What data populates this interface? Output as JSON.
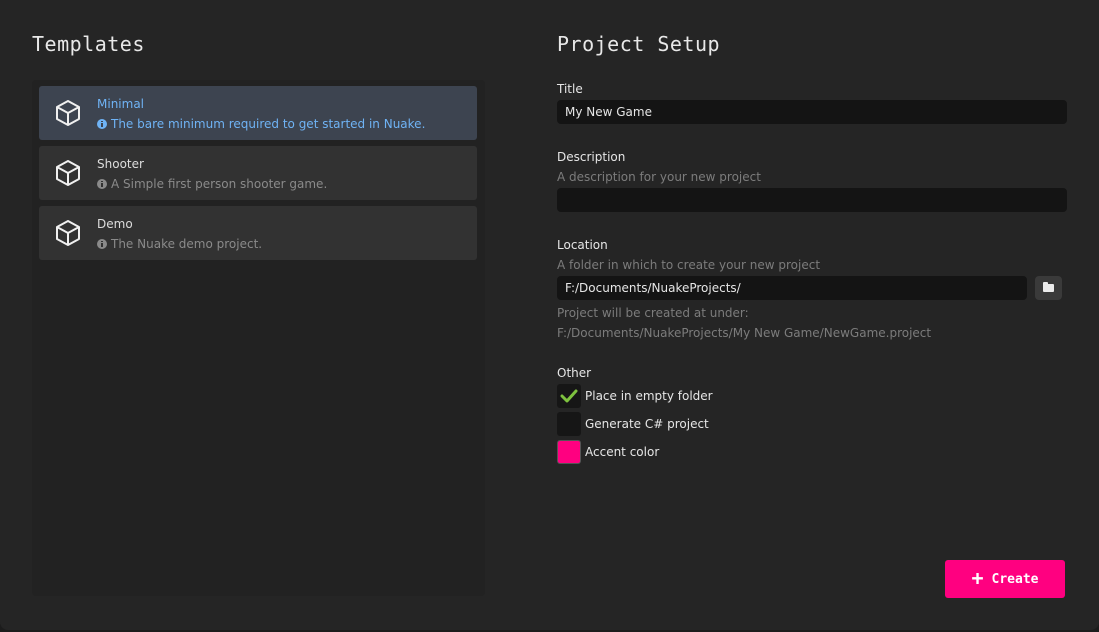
{
  "templates": {
    "title": "Templates",
    "items": [
      {
        "name": "Minimal",
        "description": "The bare minimum required to get started in Nuake.",
        "selected": true
      },
      {
        "name": "Shooter",
        "description": "A Simple first person shooter game.",
        "selected": false
      },
      {
        "name": "Demo",
        "description": "The Nuake demo project.",
        "selected": false
      }
    ]
  },
  "setup": {
    "title": "Project Setup",
    "title_label": "Title",
    "title_value": "My New Game",
    "description_label": "Description",
    "description_placeholder": "A description for your new project",
    "description_value": "",
    "location_label": "Location",
    "location_hint": "A folder in which to create your new project",
    "location_value": "F:/Documents/NuakeProjects/",
    "created_at_label": "Project will be created at under:",
    "created_at_path": "F:/Documents/NuakeProjects/My New Game/NewGame.project",
    "other_label": "Other",
    "place_in_empty_folder_label": "Place in empty folder",
    "place_in_empty_folder_checked": true,
    "generate_csharp_label": "Generate C# project",
    "generate_csharp_checked": false,
    "accent_color_label": "Accent color",
    "accent_color": "#ff0080"
  },
  "create_button": {
    "label": "Create",
    "icon": "plus-icon",
    "color": "#ff0080"
  },
  "colors": {
    "selected_text": "#6fb3f5",
    "check": "#7ec23f"
  }
}
